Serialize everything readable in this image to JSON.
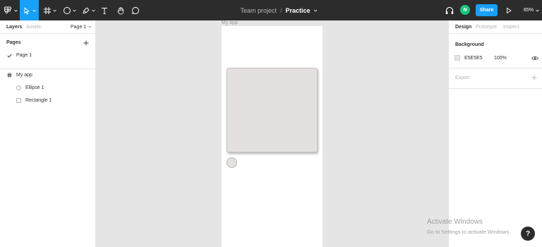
{
  "toolbar": {
    "main_menu_icon": "figma-logo-icon",
    "move_tool_icon": "cursor-arrow-icon",
    "frame_tool_icon": "frame-hash-icon",
    "shape_tool_icon": "ellipse-icon",
    "pen_tool_icon": "pen-icon",
    "text_tool_icon": "text-icon",
    "hand_tool_icon": "hand-icon",
    "comment_tool_icon": "comment-icon",
    "project_name": "Team project",
    "separator": "/",
    "file_name": "Practice",
    "user_initial": "N",
    "share_label": "Share",
    "zoom_level": "65%",
    "accent_color": "#18a0fb",
    "avatar_color": "#1bc47d"
  },
  "left_panel": {
    "tabs": [
      "Layers",
      "Assets"
    ],
    "current_page_selector": "Page 1",
    "pages_heading": "Pages",
    "pages": [
      {
        "label": "Page 1",
        "checked": true
      }
    ],
    "layers": [
      {
        "label": "My app",
        "icon": "frame-hash-icon"
      },
      {
        "label": "Ellipse 1",
        "icon": "ellipse-icon"
      },
      {
        "label": "Rectangle 1",
        "icon": "rectangle-icon"
      }
    ]
  },
  "canvas": {
    "frame_label": "My app",
    "background_color": "#e5e5e5",
    "frame_color": "#ffffff",
    "shape_fill_color": "#e5e0e0"
  },
  "right_panel": {
    "tabs": [
      "Design",
      "Prototype",
      "Inspect"
    ],
    "background_heading": "Background",
    "background_hex": "E5E5E5",
    "background_opacity": "100%",
    "export_heading": "Export"
  },
  "watermark": {
    "title": "Activate Windows",
    "subtitle": "Go to Settings to activate Windows."
  },
  "help_label": "?"
}
